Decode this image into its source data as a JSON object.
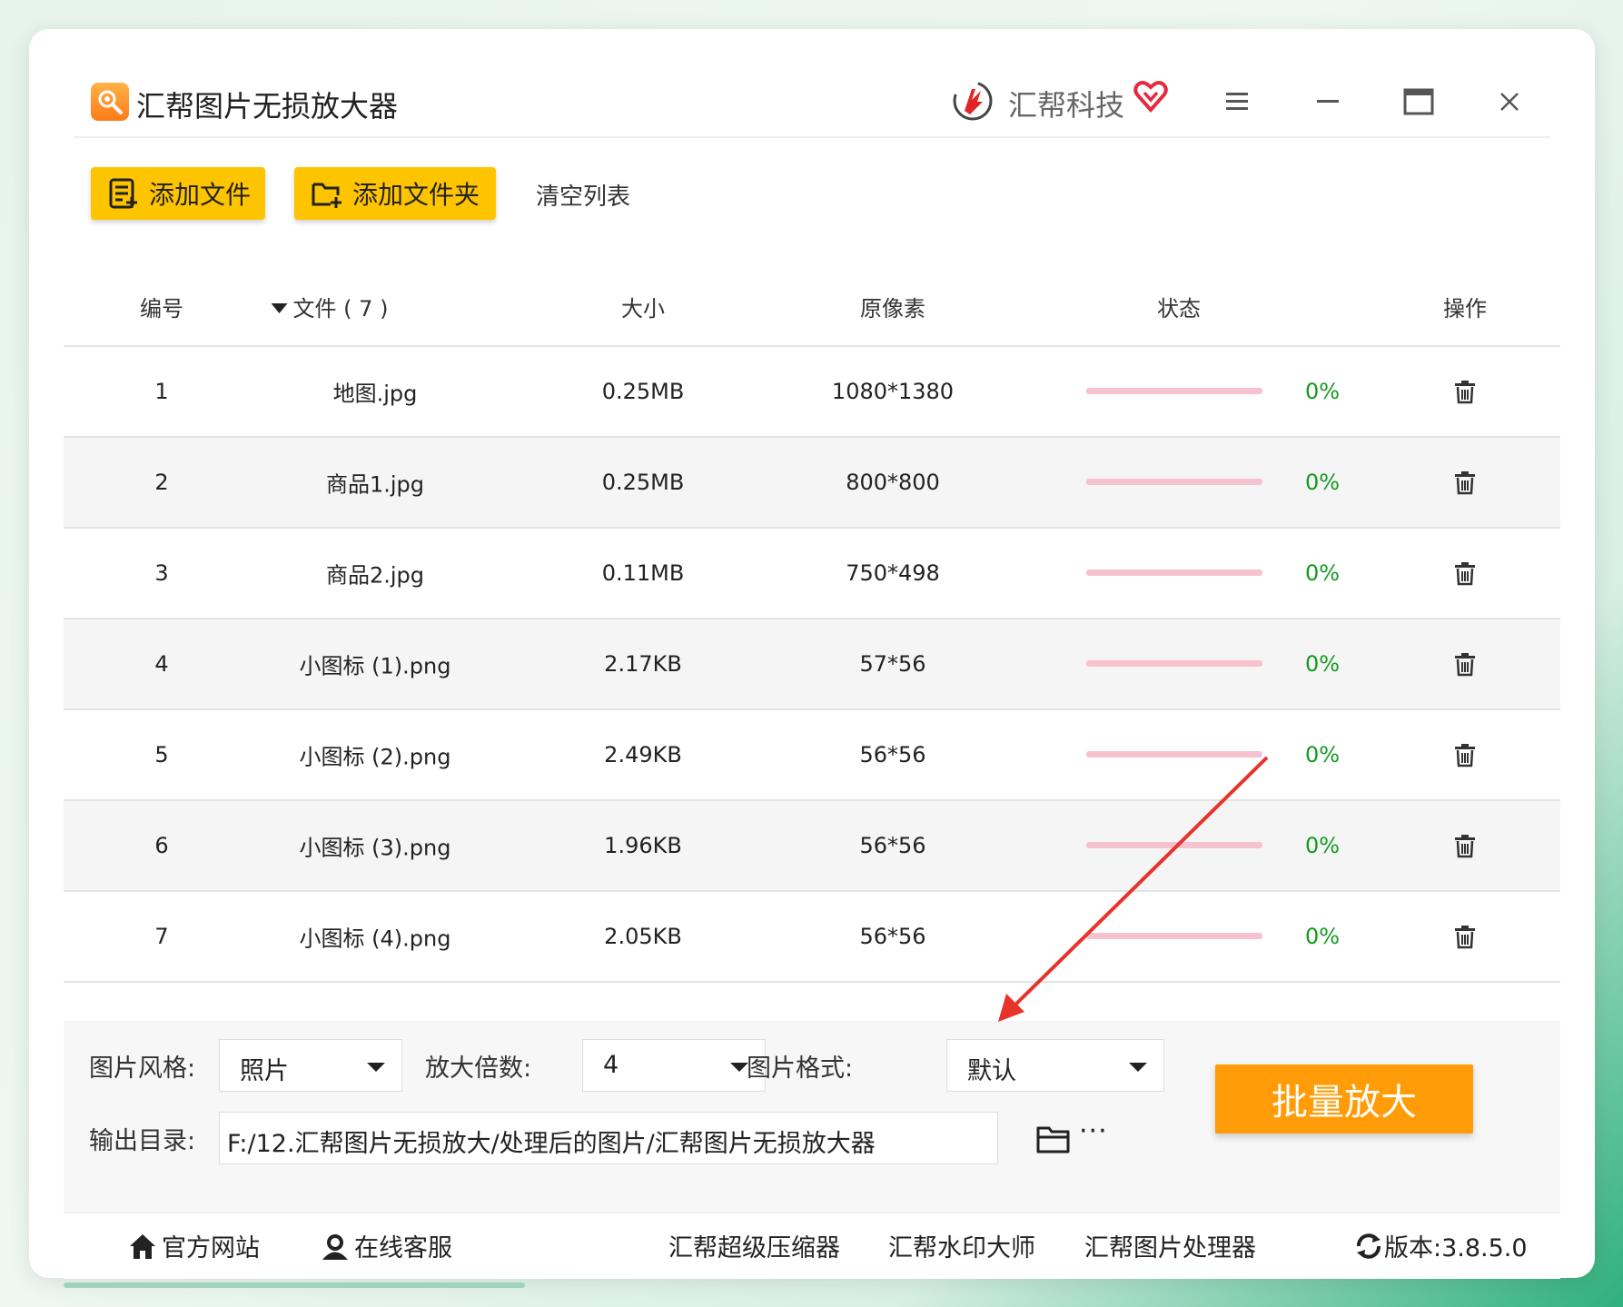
{
  "app": {
    "title": "汇帮图片无损放大器",
    "brand": "汇帮科技"
  },
  "toolbar": {
    "add_file": "添加文件",
    "add_folder": "添加文件夹",
    "clear_list": "清空列表"
  },
  "table": {
    "headers": {
      "no": "编号",
      "file": "文件 ( 7 )",
      "size": "大小",
      "pixels": "原像素",
      "status": "状态",
      "action": "操作"
    },
    "rows": [
      {
        "no": "1",
        "name": "地图.jpg",
        "size": "0.25MB",
        "pixels": "1080*1380",
        "progress": 0,
        "percent": "0%"
      },
      {
        "no": "2",
        "name": "商品1.jpg",
        "size": "0.25MB",
        "pixels": "800*800",
        "progress": 0,
        "percent": "0%"
      },
      {
        "no": "3",
        "name": "商品2.jpg",
        "size": "0.11MB",
        "pixels": "750*498",
        "progress": 0,
        "percent": "0%"
      },
      {
        "no": "4",
        "name": "小图标 (1).png",
        "size": "2.17KB",
        "pixels": "57*56",
        "progress": 0,
        "percent": "0%"
      },
      {
        "no": "5",
        "name": "小图标 (2).png",
        "size": "2.49KB",
        "pixels": "56*56",
        "progress": 0,
        "percent": "0%"
      },
      {
        "no": "6",
        "name": "小图标 (3).png",
        "size": "1.96KB",
        "pixels": "56*56",
        "progress": 0,
        "percent": "0%"
      },
      {
        "no": "7",
        "name": "小图标 (4).png",
        "size": "2.05KB",
        "pixels": "56*56",
        "progress": 0,
        "percent": "0%"
      }
    ]
  },
  "options": {
    "style_label": "图片风格:",
    "style_value": "照片",
    "scale_label": "放大倍数:",
    "scale_value": "4",
    "format_label": "图片格式:",
    "format_value": "默认",
    "output_label": "输出目录:",
    "output_path": "F:/12.汇帮图片无损放大/处理后的图片/汇帮图片无损放大器",
    "more": "···",
    "batch_button": "批量放大"
  },
  "footer": {
    "website": "官方网站",
    "service": "在线客服",
    "compressor": "汇帮超级压缩器",
    "watermark": "汇帮水印大师",
    "processor": "汇帮图片处理器",
    "version": "版本:3.8.5.0"
  },
  "colors": {
    "accent_yellow": "#ffc400",
    "batch_orange": "#ff9c07",
    "percent_green": "#139a1f",
    "progress_track": "#f7c2cf",
    "annotation_arrow": "#e8332a"
  }
}
